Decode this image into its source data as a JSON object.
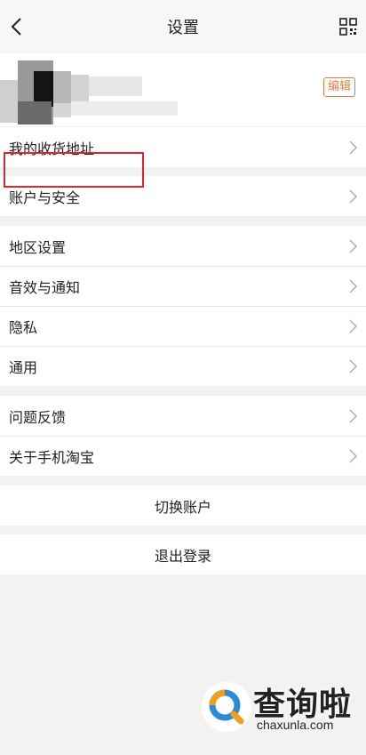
{
  "header": {
    "title": "设置",
    "back_icon": "back-arrow-icon",
    "qr_icon": "qr-code-icon"
  },
  "profile": {
    "edit_label": "编辑",
    "avatar": "blurred-avatar"
  },
  "groups": [
    {
      "items": [
        {
          "label": "我的收货地址"
        }
      ]
    },
    {
      "items": [
        {
          "label": "账户与安全"
        }
      ]
    },
    {
      "items": [
        {
          "label": "地区设置"
        },
        {
          "label": "音效与通知"
        },
        {
          "label": "隐私"
        },
        {
          "label": "通用"
        }
      ]
    },
    {
      "items": [
        {
          "label": "问题反馈"
        },
        {
          "label": "关于手机淘宝"
        }
      ]
    }
  ],
  "actions": {
    "switch_account": "切换账户",
    "logout": "退出登录"
  },
  "watermark": {
    "brand": "查询啦",
    "url": "chaxunla.com"
  },
  "colors": {
    "highlight": "#e0262c",
    "edit": "#d9804a",
    "background": "#f2f2f2"
  }
}
